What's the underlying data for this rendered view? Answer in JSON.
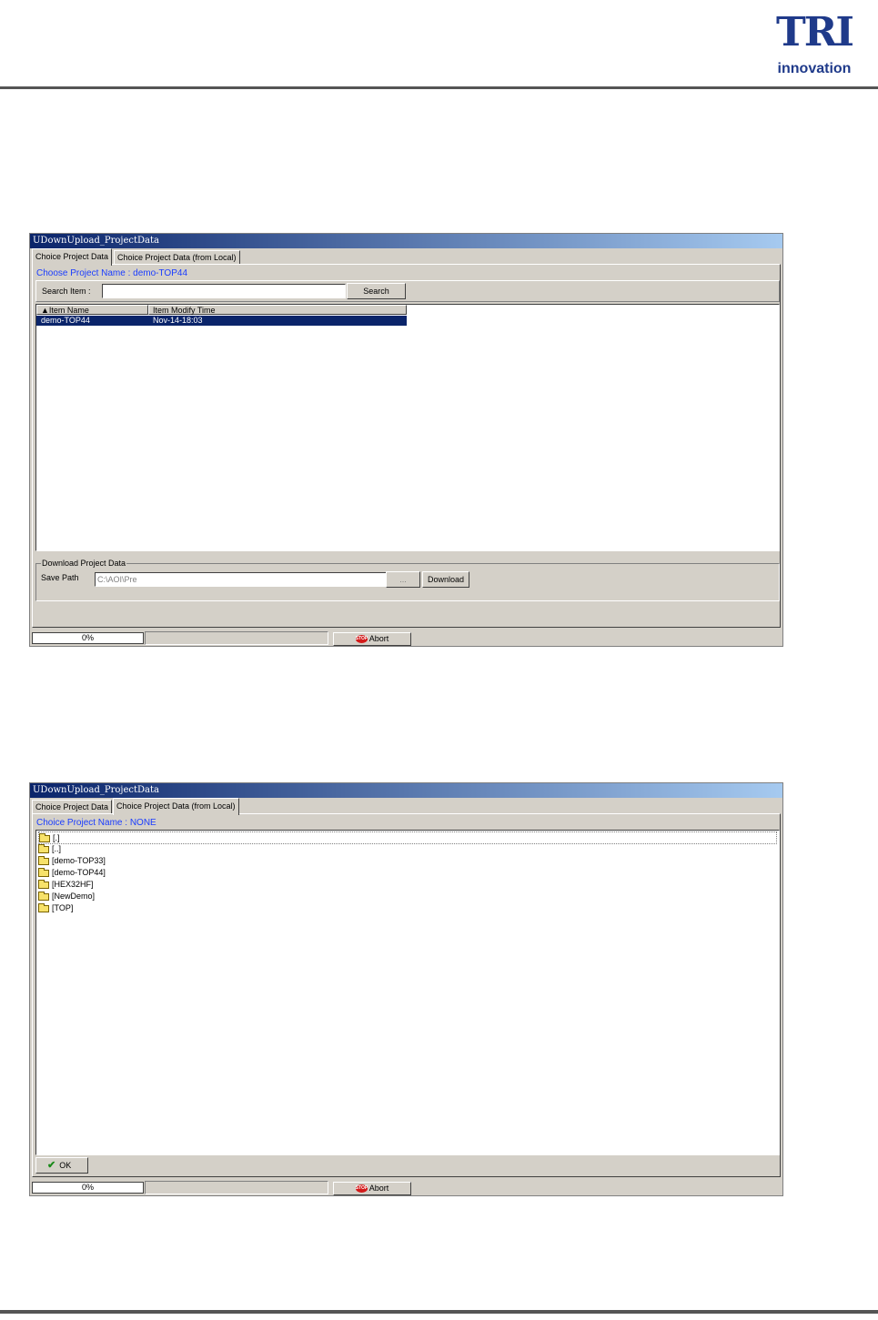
{
  "logo": {
    "name": "TRI",
    "sub": "innovation"
  },
  "window1": {
    "title": "UDownUpload_ProjectData",
    "tabs": [
      "Choice Project Data",
      "Choice Project Data (from Local)"
    ],
    "active_tab": 0,
    "project_label": "Choose Project Name : demo-TOP44",
    "search": {
      "label": "Search Item :",
      "value": "",
      "button": "Search"
    },
    "list": {
      "columns": [
        "▲Item Name",
        "Item Modify Time"
      ],
      "rows": [
        {
          "name": "demo-TOP44",
          "time": "Nov-14-18:03",
          "selected": true
        }
      ]
    },
    "download": {
      "group_title": "Download Project Data",
      "save_path_label": "Save Path",
      "save_path_value": "C:\\AOI\\Pre",
      "browse_label": "...",
      "download_label": "Download"
    },
    "status": {
      "progress_text": "0%",
      "progress_value": 0,
      "abort_label": "Abort",
      "stop_icon_text": "STOP"
    }
  },
  "window2": {
    "title": "UDownUpload_ProjectData",
    "tabs": [
      "Choice Project Data",
      "Choice Project Data (from Local)"
    ],
    "active_tab": 1,
    "project_label": "Choice Project Name : NONE",
    "folders": [
      "[.]",
      "[..]",
      "[demo-TOP33]",
      "[demo-TOP44]",
      "[HEX32HF]",
      "[NewDemo]",
      "[TOP]"
    ],
    "ok_label": "OK",
    "status": {
      "progress_text": "0%",
      "progress_value": 0,
      "abort_label": "Abort",
      "stop_icon_text": "STOP"
    }
  },
  "colors": {
    "titlebar": "#0a246a",
    "selection": "#0a246a",
    "label_blue": "#1a3cff",
    "face": "#d4d0c8"
  }
}
